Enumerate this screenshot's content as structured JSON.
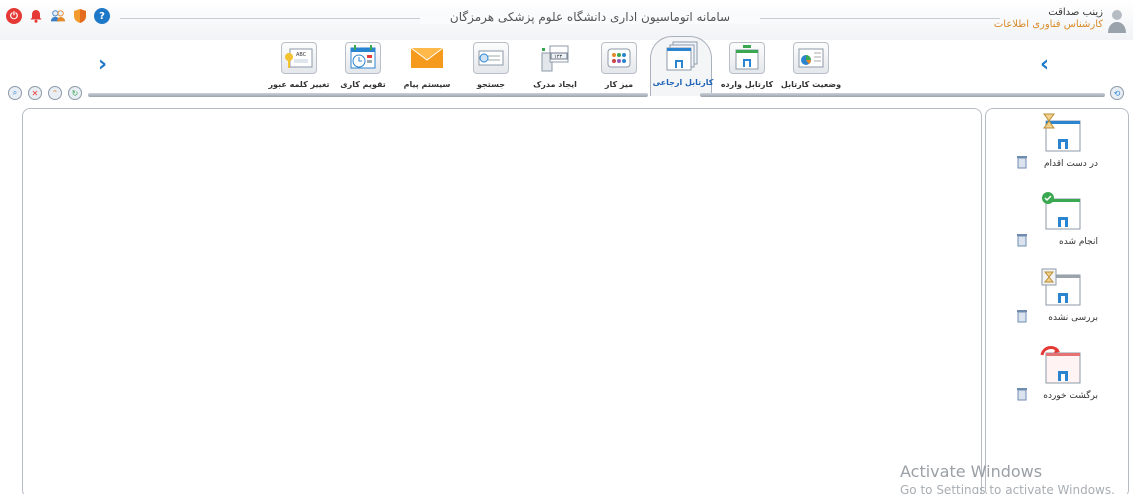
{
  "app": {
    "title": "سامانه اتوماسیون اداری دانشگاه علوم پزشکی هرمزگان"
  },
  "user": {
    "name": "زینب صداقت",
    "role": "کارشناس فناوری اطلاعات"
  },
  "top_icons": [
    "power-icon",
    "bell-icon",
    "users-icon",
    "shield-icon",
    "help-icon"
  ],
  "toolbar": {
    "items": [
      {
        "label": "وضعیت کارتابل",
        "icon": "status-icon"
      },
      {
        "label": "کارتابل وارده",
        "icon": "inbox-icon"
      },
      {
        "label": "کارتابل ارجاعی",
        "icon": "referral-icon",
        "active": true
      },
      {
        "label": "میز کار",
        "icon": "desk-icon"
      },
      {
        "label": "ایجاد مدرک",
        "icon": "create-doc-icon"
      },
      {
        "label": "جستجو",
        "icon": "search-icon"
      },
      {
        "label": "سیستم پیام",
        "icon": "message-icon"
      },
      {
        "label": "تقویم کاری",
        "icon": "calendar-icon"
      },
      {
        "label": "تغییر کلمه عبور",
        "icon": "password-icon"
      }
    ],
    "doc_number": "۱۲۳",
    "keyboard_text": "ABC"
  },
  "side_panel": {
    "items": [
      {
        "label": "در دست اقدام",
        "icon": "in-progress-icon"
      },
      {
        "label": "انجام شده",
        "icon": "done-icon"
      },
      {
        "label": "بررسی نشده",
        "icon": "unreviewed-icon"
      },
      {
        "label": "برگشت خورده",
        "icon": "returned-icon"
      }
    ]
  },
  "watermark": {
    "line1": "Activate Windows",
    "line2": "Go to Settings to activate Windows."
  },
  "colors": {
    "accent": "#1e78c8",
    "role": "#d88a2a",
    "power": "#e53935",
    "bell": "#e53935"
  }
}
